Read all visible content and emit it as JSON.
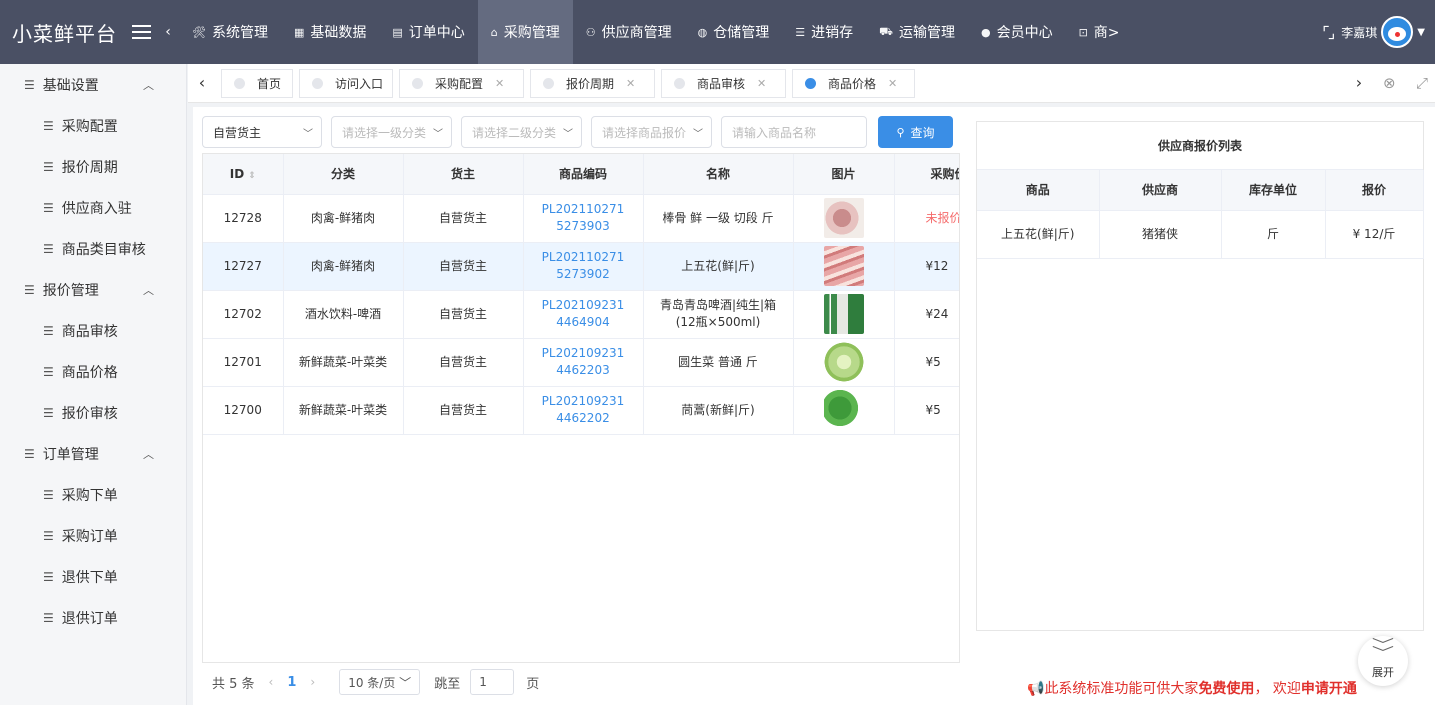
{
  "brand": "小菜鲜平台",
  "nav": [
    {
      "icon": "🛠",
      "label": "系统管理"
    },
    {
      "icon": "▦",
      "label": "基础数据"
    },
    {
      "icon": "▤",
      "label": "订单中心"
    },
    {
      "icon": "⌂",
      "label": "采购管理",
      "active": true
    },
    {
      "icon": "⚇",
      "label": "供应商管理"
    },
    {
      "icon": "◍",
      "label": "仓储管理"
    },
    {
      "icon": "☰",
      "label": "进销存"
    },
    {
      "icon": "⛟",
      "label": "运输管理"
    },
    {
      "icon": "●",
      "label": "会员中心"
    },
    {
      "icon": "⊡",
      "label": "商>"
    }
  ],
  "user": {
    "name": "李嘉琪"
  },
  "sidebar": [
    {
      "type": "group",
      "label": "基础设置"
    },
    {
      "type": "item",
      "label": "采购配置"
    },
    {
      "type": "item",
      "label": "报价周期"
    },
    {
      "type": "item",
      "label": "供应商入驻"
    },
    {
      "type": "item",
      "label": "商品类目审核"
    },
    {
      "type": "group",
      "label": "报价管理"
    },
    {
      "type": "item",
      "label": "商品审核"
    },
    {
      "type": "item",
      "label": "商品价格"
    },
    {
      "type": "item",
      "label": "报价审核"
    },
    {
      "type": "group",
      "label": "订单管理"
    },
    {
      "type": "item",
      "label": "采购下单"
    },
    {
      "type": "item",
      "label": "采购订单"
    },
    {
      "type": "item",
      "label": "退供下单"
    },
    {
      "type": "item",
      "label": "退供订单"
    }
  ],
  "tabs": [
    {
      "label": "首页",
      "closable": false
    },
    {
      "label": "访问入口",
      "closable": false
    },
    {
      "label": "采购配置",
      "closable": true
    },
    {
      "label": "报价周期",
      "closable": true
    },
    {
      "label": "商品审核",
      "closable": true
    },
    {
      "label": "商品价格",
      "closable": true,
      "active": true
    }
  ],
  "filters": {
    "owner": "自营货主",
    "cat1_placeholder": "请选择一级分类",
    "cat2_placeholder": "请选择二级分类",
    "quote_placeholder": "请选择商品报价",
    "name_placeholder": "请输入商品名称",
    "search_label": "查询"
  },
  "table": {
    "headers": [
      "ID",
      "分类",
      "货主",
      "商品编码",
      "名称",
      "图片",
      "采购价"
    ],
    "rows": [
      {
        "id": "12728",
        "category": "肉禽-鲜猪肉",
        "owner": "自营货主",
        "code": "PL2021102715273903",
        "name": "棒骨 鲜 一级 切段 斤",
        "price": "未报价",
        "price_red": true,
        "img": "pork-bone"
      },
      {
        "id": "12727",
        "category": "肉禽-鲜猪肉",
        "owner": "自营货主",
        "code": "PL2021102715273902",
        "name": "上五花(鲜|斤)",
        "price": "¥12",
        "selected": true,
        "img": "pork-belly"
      },
      {
        "id": "12702",
        "category": "酒水饮料-啤酒",
        "owner": "自营货主",
        "code": "PL2021092314464904",
        "name": "青岛青岛啤酒|纯生|箱(12瓶×500ml)",
        "price": "¥24",
        "img": "beer"
      },
      {
        "id": "12701",
        "category": "新鲜蔬菜-叶菜类",
        "owner": "自营货主",
        "code": "PL2021092314462203",
        "name": "圆生菜 普通 斤",
        "price": "¥5",
        "img": "lettuce"
      },
      {
        "id": "12700",
        "category": "新鲜蔬菜-叶菜类",
        "owner": "自营货主",
        "code": "PL2021092314462202",
        "name": "茼蒿(新鲜|斤)",
        "price": "¥5",
        "img": "crown-daisy"
      }
    ]
  },
  "pager": {
    "total": "共 5 条",
    "current": "1",
    "size": "10 条/页",
    "goto_label": "跳至",
    "goto_value": "1",
    "page_suffix": "页"
  },
  "quote_panel": {
    "title": "供应商报价列表",
    "headers": [
      "商品",
      "供应商",
      "库存单位",
      "报价"
    ],
    "rows": [
      {
        "product": "上五花(鲜|斤)",
        "supplier": "猪猪侠",
        "unit": "斤",
        "price": "¥ 12/斤"
      }
    ]
  },
  "notice": {
    "icon": "📢",
    "text1": "此系统标准功能可供大家",
    "bold1": "免费使用",
    "text2": "， 欢迎",
    "bold2": "申请开通"
  },
  "expand_label": "展开",
  "colors": {
    "accent": "#3a8ee6",
    "topbar": "#4a5064",
    "danger": "#f56c6c"
  }
}
